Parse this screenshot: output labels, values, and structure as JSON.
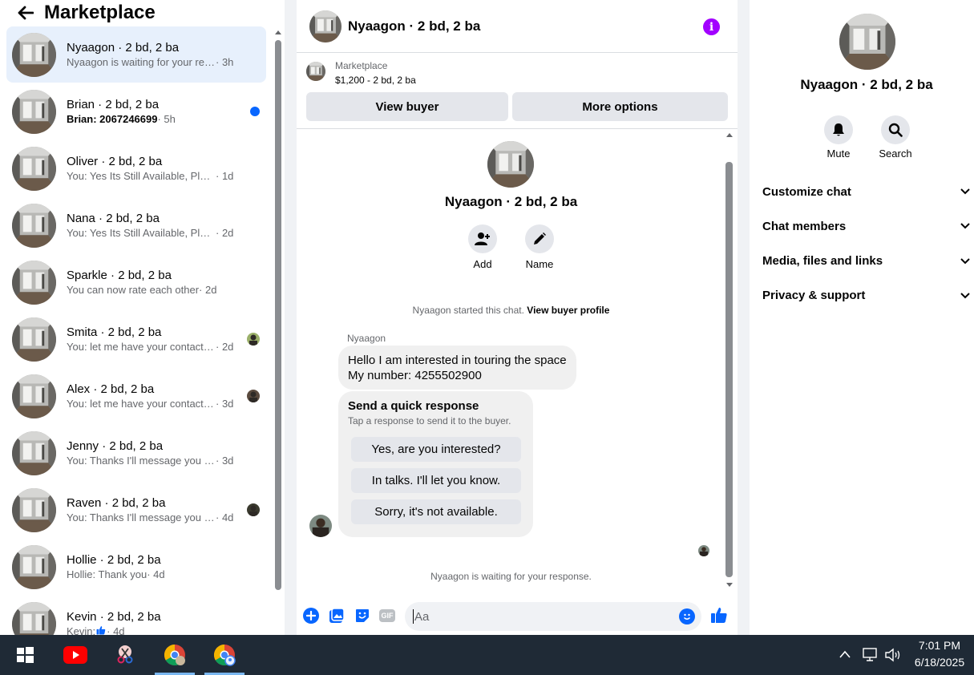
{
  "left_panel": {
    "title": "Marketplace",
    "conversations": [
      {
        "name": "Nyaagon · 2 bd, 2 ba",
        "preview": "Nyaagon is waiting for your respon...",
        "time": "· 3h",
        "active": true
      },
      {
        "name": "Brian · 2 bd, 2 ba",
        "preview": "Brian: 2067246699",
        "time": " · 5h",
        "unread": true
      },
      {
        "name": "Oliver · 2 bd, 2 ba",
        "preview": "You: Yes Its Still Available, Please Se...",
        "time": " · 1d"
      },
      {
        "name": "Nana · 2 bd, 2 ba",
        "preview": "You: Yes Its Still Available, Please Se...",
        "time": " · 2d"
      },
      {
        "name": "Sparkle · 2 bd, 2 ba",
        "preview": "You can now rate each other",
        "time": " · 2d"
      },
      {
        "name": "Smita · 2 bd, 2 ba",
        "preview": "You: let me have your contact n...",
        "time": " · 2d",
        "mini": "#9bb06a"
      },
      {
        "name": "Alex · 2 bd, 2 ba",
        "preview": "You: let me have your contact n...",
        "time": " · 3d",
        "mini": "#5a4a3e"
      },
      {
        "name": "Jenny · 2 bd, 2 ba",
        "preview": "You: Thanks I'll message you in a m...",
        "time": " · 3d"
      },
      {
        "name": "Raven · 2 bd, 2 ba",
        "preview": "You: Thanks I'll message you in ...",
        "time": " · 4d",
        "mini": "#3a3a2e"
      },
      {
        "name": "Hollie · 2 bd, 2 ba",
        "preview": "Hollie: Thank you",
        "time": " · 4d"
      },
      {
        "name": "Kevin · 2 bd, 2 ba",
        "preview": "Kevin: ",
        "time": " · 4d",
        "thumb": true
      }
    ]
  },
  "chat": {
    "title": "Nyaagon · 2 bd, 2 ba",
    "listing": {
      "label": "Marketplace",
      "price": "$1,200 - 2 bd, 2 ba"
    },
    "view_buyer": "View buyer",
    "more_options": "More options",
    "profile_name": "Nyaagon · 2 bd, 2 ba",
    "add_label": "Add",
    "name_label": "Name",
    "started_text": "Nyaagon started this chat.",
    "view_profile": "View buyer profile",
    "sender": "Nyaagon",
    "message_line1": "Hello I am interested in touring the space",
    "message_line2": "My number: 4255502900",
    "quick_title": "Send a quick response",
    "quick_subtitle": "Tap a response to send it to the buyer.",
    "quick_responses": [
      "Yes, are you interested?",
      "In talks. I'll let you know.",
      "Sorry, it's not available."
    ],
    "waiting": "Nyaagon is waiting for your response.",
    "input_placeholder": "Aa"
  },
  "details": {
    "name": "Nyaagon · 2 bd, 2 ba",
    "mute": "Mute",
    "search": "Search",
    "sections": [
      "Customize chat",
      "Chat members",
      "Media, files and links",
      "Privacy & support"
    ]
  },
  "taskbar": {
    "time": "7:01 PM",
    "date": "6/18/2025"
  },
  "colors": {
    "accent": "#0866ff",
    "info": "#a200ff",
    "active_bg": "#e7f0fc",
    "taskbar": "#1f2a36"
  }
}
